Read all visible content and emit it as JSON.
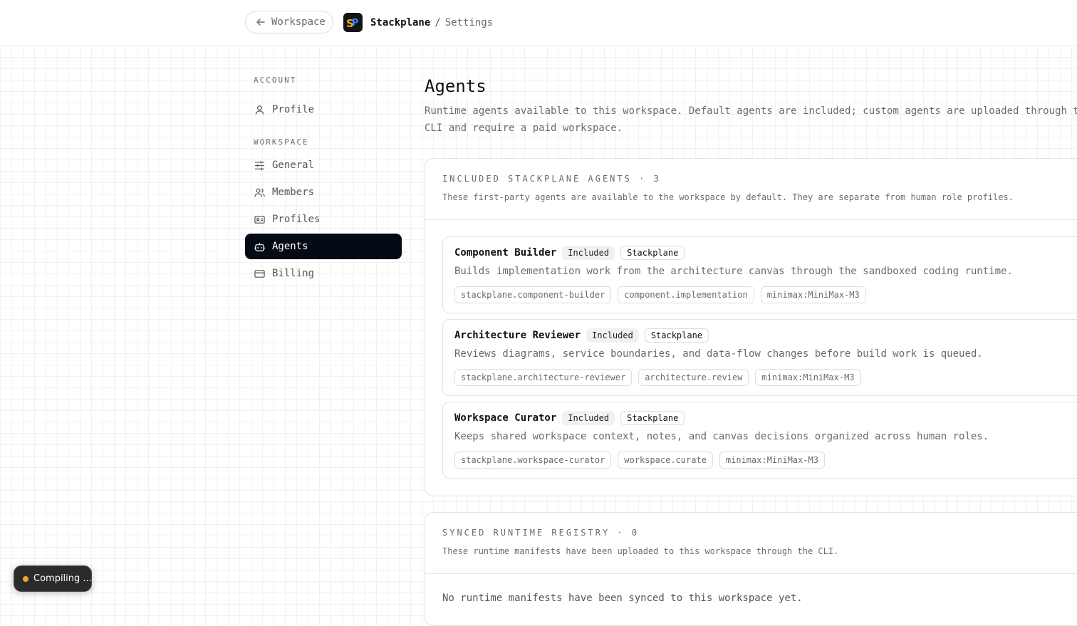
{
  "topbar": {
    "back_label": "Workspace",
    "app_name": "Stackplane",
    "separator": "/",
    "page_name": "Settings",
    "logo_colors": [
      "#f5a524",
      "#3b82f6"
    ]
  },
  "sidebar": {
    "account_label": "ACCOUNT",
    "workspace_label": "WORKSPACE",
    "account_items": [
      {
        "label": "Profile",
        "icon": "user-icon"
      }
    ],
    "workspace_items": [
      {
        "label": "General",
        "icon": "sliders-icon"
      },
      {
        "label": "Members",
        "icon": "users-icon"
      },
      {
        "label": "Profiles",
        "icon": "id-card-icon"
      },
      {
        "label": "Agents",
        "icon": "bot-icon",
        "active": true
      },
      {
        "label": "Billing",
        "icon": "credit-card-icon"
      }
    ]
  },
  "main": {
    "title": "Agents",
    "description": "Runtime agents available to this workspace. Default agents are included; custom agents are uploaded through the CLI and require a paid workspace."
  },
  "included": {
    "title": "INCLUDED STACKPLANE AGENTS · 3",
    "subtitle": "These first-party agents are available to the workspace by default. They are separate from human role profiles.",
    "agents": [
      {
        "name": "Component Builder",
        "badge": "Included",
        "vendor": "Stackplane",
        "description": "Builds implementation work from the architecture canvas through the sandboxed coding runtime.",
        "tags": [
          "stackplane.component-builder",
          "component.implementation",
          "minimax:MiniMax-M3"
        ]
      },
      {
        "name": "Architecture Reviewer",
        "badge": "Included",
        "vendor": "Stackplane",
        "description": "Reviews diagrams, service boundaries, and data-flow changes before build work is queued.",
        "tags": [
          "stackplane.architecture-reviewer",
          "architecture.review",
          "minimax:MiniMax-M3"
        ]
      },
      {
        "name": "Workspace Curator",
        "badge": "Included",
        "vendor": "Stackplane",
        "description": "Keeps shared workspace context, notes, and canvas decisions organized across human roles.",
        "tags": [
          "stackplane.workspace-curator",
          "workspace.curate",
          "minimax:MiniMax-M3"
        ]
      }
    ]
  },
  "synced": {
    "title": "SYNCED RUNTIME REGISTRY · 0",
    "subtitle": "These runtime manifests have been uploaded to this workspace through the CLI.",
    "empty_message": "No runtime manifests have been synced to this workspace yet."
  },
  "toast": {
    "label": "Compiling ...",
    "status_color": "#f5a524"
  }
}
